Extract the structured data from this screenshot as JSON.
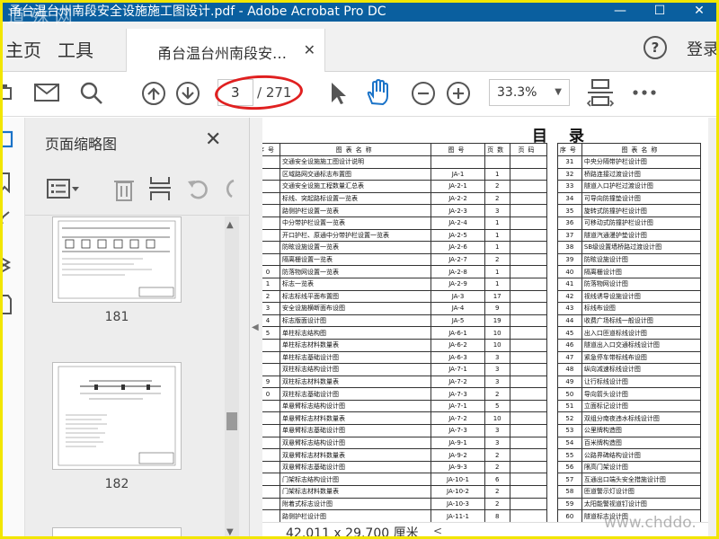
{
  "window": {
    "title": "甬台温台州南段安全设施施工图设计.pdf - Adobe Acrobat Pro DC",
    "minimize": "—",
    "maximize": "☐",
    "close": "✕"
  },
  "tabs": {
    "home": "主页",
    "tools": "工具",
    "document_tab": "甬台温台州南段安…",
    "document_tab_close": "✕",
    "help": "?",
    "login": "登录"
  },
  "toolbar": {
    "current_page": "3",
    "total_pages": "/ 271",
    "zoom": "33.3%",
    "accent_color": "#1a73c8"
  },
  "thumbnail_panel": {
    "title": "页面缩略图",
    "close": "✕",
    "thumbnails": [
      {
        "page": "181"
      },
      {
        "page": "182"
      }
    ]
  },
  "document": {
    "heading": "目录",
    "headers": {
      "no": "序号",
      "name": "图表名称",
      "code": "图号",
      "pages": "页数",
      "page_no": "页码",
      "no2": "序号",
      "name2": "图表名称"
    },
    "left_rows": [
      {
        "no": "",
        "name": "交通安全设施施工图设计说明",
        "code": "",
        "pages": ""
      },
      {
        "no": "",
        "name": "区域路网交通标志布置图",
        "code": "JA-1",
        "pages": "1"
      },
      {
        "no": "",
        "name": "交通安全设施工程数量汇总表",
        "code": "JA-2-1",
        "pages": "2"
      },
      {
        "no": "",
        "name": "标线、突起路标设置一览表",
        "code": "JA-2-2",
        "pages": "2"
      },
      {
        "no": "",
        "name": "路侧护栏设置一览表",
        "code": "JA-2-3",
        "pages": "3"
      },
      {
        "no": "",
        "name": "中分带护栏设置一览表",
        "code": "JA-2-4",
        "pages": "1"
      },
      {
        "no": "",
        "name": "开口护栏、原通中分带护栏设置一览表",
        "code": "JA-2-5",
        "pages": "1"
      },
      {
        "no": "",
        "name": "防眩设施设置一览表",
        "code": "JA-2-6",
        "pages": "1"
      },
      {
        "no": "",
        "name": "隔离栅设置一览表",
        "code": "JA-2-7",
        "pages": "2"
      },
      {
        "no": "0",
        "name": "防落物网设置一览表",
        "code": "JA-2-8",
        "pages": "1"
      },
      {
        "no": "1",
        "name": "标志一览表",
        "code": "JA-2-9",
        "pages": "1"
      },
      {
        "no": "2",
        "name": "标志标线平面布置图",
        "code": "JA-3",
        "pages": "17"
      },
      {
        "no": "3",
        "name": "安全设施横断面布设图",
        "code": "JA-4",
        "pages": "9"
      },
      {
        "no": "4",
        "name": "标志版面设计图",
        "code": "JA-5",
        "pages": "19"
      },
      {
        "no": "5",
        "name": "单柱标志结构图",
        "code": "JA-6-1",
        "pages": "10"
      },
      {
        "no": "",
        "name": "单柱标志材料数量表",
        "code": "JA-6-2",
        "pages": "10"
      },
      {
        "no": "",
        "name": "单柱标志基础设计图",
        "code": "JA-6-3",
        "pages": "3"
      },
      {
        "no": "",
        "name": "双柱标志结构设计图",
        "code": "JA-7-1",
        "pages": "3"
      },
      {
        "no": "9",
        "name": "双柱标志材料数量表",
        "code": "JA-7-2",
        "pages": "3"
      },
      {
        "no": "0",
        "name": "双柱标志基础设计图",
        "code": "JA-7-3",
        "pages": "2"
      },
      {
        "no": "",
        "name": "单悬臂标志结构设计图",
        "code": "JA-7-1",
        "pages": "5"
      },
      {
        "no": "",
        "name": "单悬臂标志材料数量表",
        "code": "JA-7-2",
        "pages": "10"
      },
      {
        "no": "",
        "name": "单悬臂标志基础设计图",
        "code": "JA-7-3",
        "pages": "3"
      },
      {
        "no": "",
        "name": "双悬臂标志结构设计图",
        "code": "JA-9-1",
        "pages": "3"
      },
      {
        "no": "",
        "name": "双悬臂标志材料数量表",
        "code": "JA-9-2",
        "pages": "2"
      },
      {
        "no": "",
        "name": "双悬臂标志基础设计图",
        "code": "JA-9-3",
        "pages": "2"
      },
      {
        "no": "",
        "name": "门架标志结构设计图",
        "code": "JA-10-1",
        "pages": "6"
      },
      {
        "no": "",
        "name": "门架标志材料数量表",
        "code": "JA-10-2",
        "pages": "2"
      },
      {
        "no": "",
        "name": "附着式标志设计图",
        "code": "JA-10-3",
        "pages": "2"
      },
      {
        "no": "",
        "name": "路侧护栏设计图",
        "code": "JA-11-1",
        "pages": "8"
      }
    ],
    "right_rows": [
      {
        "no": "31",
        "name": "中央分隔带护栏设计图"
      },
      {
        "no": "32",
        "name": "桥路连接过渡设计图"
      },
      {
        "no": "33",
        "name": "隧道入口护栏过渡设计图"
      },
      {
        "no": "34",
        "name": "可导向防撞垫设计图"
      },
      {
        "no": "35",
        "name": "旋转式防撞护栏设计图"
      },
      {
        "no": "36",
        "name": "可移动式防撞护栏设计图"
      },
      {
        "no": "37",
        "name": "隧道汽通漫护垫设计图"
      },
      {
        "no": "38",
        "name": "SB级设置墙桥路过渡设计图"
      },
      {
        "no": "39",
        "name": "防眩设施设计图"
      },
      {
        "no": "40",
        "name": "隔离栅设计图"
      },
      {
        "no": "41",
        "name": "防落物网设计图"
      },
      {
        "no": "42",
        "name": "视线诱导设施设计图"
      },
      {
        "no": "43",
        "name": "标线布设图"
      },
      {
        "no": "44",
        "name": "收费广场标线一般设计图"
      },
      {
        "no": "45",
        "name": "出入口匝道标线设计图"
      },
      {
        "no": "46",
        "name": "隧道出入口交通标线设计图"
      },
      {
        "no": "47",
        "name": "紧急停车带标线布设图"
      },
      {
        "no": "48",
        "name": "纵向减速标线设计图"
      },
      {
        "no": "49",
        "name": "让行标线设计图"
      },
      {
        "no": "50",
        "name": "导向箭头设计图"
      },
      {
        "no": "51",
        "name": "立面标记设计图"
      },
      {
        "no": "52",
        "name": "双组分南夜违水标线设计图"
      },
      {
        "no": "53",
        "name": "公里牌构造图"
      },
      {
        "no": "54",
        "name": "百米牌构造图"
      },
      {
        "no": "55",
        "name": "公路界碑结构设计图"
      },
      {
        "no": "56",
        "name": "限高门架设计图"
      },
      {
        "no": "57",
        "name": "互通出口端头安全措施设计图"
      },
      {
        "no": "58",
        "name": "匝道警示灯设计图"
      },
      {
        "no": "59",
        "name": "太阳能警视道钉设计图"
      },
      {
        "no": "60",
        "name": "隧道标志设计图"
      }
    ]
  },
  "statusbar": {
    "page_size": "42.011 x 29.700 厘米"
  },
  "watermarks": {
    "top_left": "道 殊 网",
    "bottom_right": "www.chddo."
  }
}
